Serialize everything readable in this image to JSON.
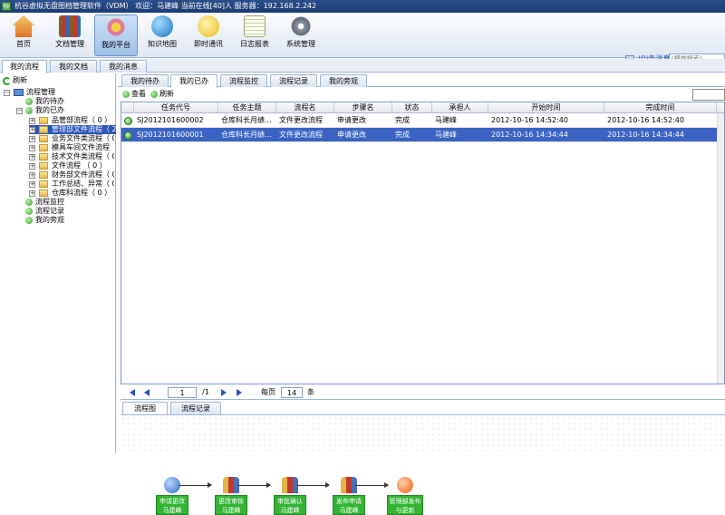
{
  "window": {
    "title": "杭谷虚拟无盘图档管理软件（VDM） 欢迎：马建峰 当前在线[40]人 服务器：192.168.2.242"
  },
  "toolbar": {
    "items": [
      {
        "label": "首页",
        "icon": "home-icon",
        "active": false
      },
      {
        "label": "文档管理",
        "icon": "books-icon",
        "active": false
      },
      {
        "label": "我的平台",
        "icon": "flower-icon",
        "active": true
      },
      {
        "label": "知识地图",
        "icon": "globe-icon",
        "active": false
      },
      {
        "label": "即时通讯",
        "icon": "chat-icon",
        "active": false
      },
      {
        "label": "日志报表",
        "icon": "notepad-icon",
        "active": false
      },
      {
        "label": "系统管理",
        "icon": "gears-icon",
        "active": false
      }
    ],
    "message_link": "(0)条消息",
    "search_placeholder": "(模糊搜索)"
  },
  "main_tabs": [
    "我的流程",
    "我的文档",
    "我的消息"
  ],
  "left": {
    "refresh_label": "刷新",
    "tree": [
      {
        "label": "流程管理",
        "level": 0,
        "type": "root"
      },
      {
        "label": "我的待办",
        "level": 1,
        "type": "item"
      },
      {
        "label": "我的已办",
        "level": 1,
        "type": "expanded"
      },
      {
        "label": "品管部流程（ 0 ）",
        "level": 2,
        "type": "folder"
      },
      {
        "label": "管理部文件流程（ 2 ）",
        "level": 2,
        "type": "folder",
        "selected": true
      },
      {
        "label": "业务文件类流程（ 0 ）",
        "level": 2,
        "type": "folder"
      },
      {
        "label": "模具车间文件流程（ 0 ）",
        "level": 2,
        "type": "folder"
      },
      {
        "label": "技术文件类流程（ 0 ）",
        "level": 2,
        "type": "folder"
      },
      {
        "label": "文件流程 （ 0 ）",
        "level": 2,
        "type": "folder"
      },
      {
        "label": "财务部文件流程（ 0 ）",
        "level": 2,
        "type": "folder"
      },
      {
        "label": "工作总结、异常（ 0 ）",
        "level": 2,
        "type": "folder"
      },
      {
        "label": "仓库科流程（ 0 ）",
        "level": 2,
        "type": "folder"
      },
      {
        "label": "流程监控",
        "level": 1,
        "type": "item"
      },
      {
        "label": "流程记录",
        "level": 1,
        "type": "item"
      },
      {
        "label": "我的旁观",
        "level": 1,
        "type": "item"
      }
    ]
  },
  "sub_tabs": [
    "我的待办",
    "我的已办",
    "流程监控",
    "流程记录",
    "我的旁观"
  ],
  "actions": {
    "view_label": "查看",
    "refresh_label": "刷新"
  },
  "table": {
    "columns": [
      "任务代号",
      "任务主题",
      "流程名",
      "步骤名",
      "状态",
      "承担人",
      "开始时间",
      "完成时间"
    ],
    "rows": [
      {
        "id": "SJ2012101600002",
        "subject": "仓库科长月绩...",
        "flow": "文件更改流程",
        "step": "申请更改",
        "status": "完成",
        "owner": "马建峰",
        "start": "2012-10-16 14:52:40",
        "end": "2012-10-16 14:52:40"
      },
      {
        "id": "SJ2012101600001",
        "subject": "仓库科长月绩...",
        "flow": "文件更改流程",
        "step": "申请更改",
        "status": "完成",
        "owner": "马建峰",
        "start": "2012-10-16 14:34:44",
        "end": "2012-10-16 14:34:44"
      }
    ]
  },
  "pager": {
    "page": "1",
    "total": "/1",
    "per_page_label": "每页",
    "per_page": "14",
    "unit": "条"
  },
  "bottom_tabs": [
    "流程图",
    "流程记录"
  ],
  "flow": {
    "nodes": [
      {
        "line1": "申请更改",
        "line2": "马建峰",
        "icon": "start-icon"
      },
      {
        "line1": "更改审核",
        "line2": "马建峰",
        "icon": "people-icon"
      },
      {
        "line1": "审批确认",
        "line2": "马建峰",
        "icon": "people-icon"
      },
      {
        "line1": "发布申请",
        "line2": "马建峰",
        "icon": "people-icon"
      },
      {
        "line1": "管理部发布",
        "line2": "与更新",
        "icon": "stop-icon"
      }
    ]
  }
}
